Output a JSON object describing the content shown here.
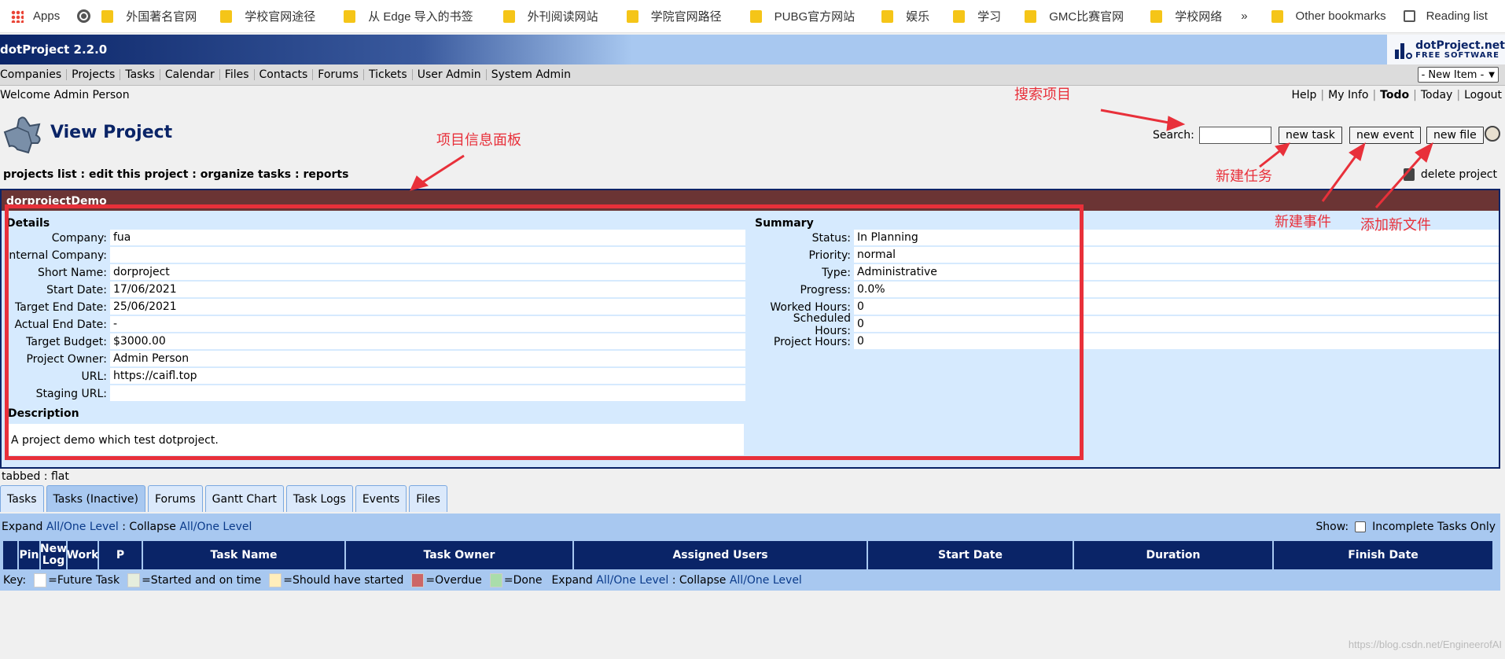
{
  "bookmarks": {
    "apps": "Apps",
    "folders": [
      "外国著名官网",
      "学校官网途径",
      "从 Edge 导入的书签",
      "外刊阅读网站",
      "学院官网路径",
      "PUBG官方网站",
      "娱乐",
      "学习",
      "GMC比赛官网",
      "学校网络"
    ],
    "more": "»",
    "other": "Other bookmarks",
    "reading_list": "Reading list"
  },
  "header": {
    "version": "dotProject 2.2.0",
    "logo_line1": "dotProject.net",
    "logo_line2": "FREE SOFTWARE"
  },
  "nav": [
    "Companies",
    "Projects",
    "Tasks",
    "Calendar",
    "Files",
    "Contacts",
    "Forums",
    "Tickets",
    "User Admin",
    "System Admin"
  ],
  "new_item": "- New Item -",
  "welcome": "Welcome Admin Person",
  "top_links": [
    "Help",
    "My Info",
    "Todo",
    "Today",
    "Logout"
  ],
  "page_title": "View Project",
  "search_label": "Search:",
  "buttons": {
    "new_task": "new task",
    "new_event": "new event",
    "new_file": "new file"
  },
  "project_links": "projects list : edit this project : organize tasks : reports",
  "delete_project": "delete project",
  "project": {
    "name": "dorprojectDemo",
    "details_heading": "Details",
    "details": [
      {
        "label": "Company:",
        "value": "fua"
      },
      {
        "label": "Internal Company:",
        "value": ""
      },
      {
        "label": "Short Name:",
        "value": "dorproject"
      },
      {
        "label": "Start Date:",
        "value": "17/06/2021"
      },
      {
        "label": "Target End Date:",
        "value": "25/06/2021"
      },
      {
        "label": "Actual End Date:",
        "value": "-"
      },
      {
        "label": "Target Budget:",
        "value": "$3000.00"
      },
      {
        "label": "Project Owner:",
        "value": "Admin Person"
      },
      {
        "label": "URL:",
        "value": "https://caifl.top"
      },
      {
        "label": "Staging URL:",
        "value": ""
      }
    ],
    "summary_heading": "Summary",
    "summary": [
      {
        "label": "Status:",
        "value": "In Planning"
      },
      {
        "label": "Priority:",
        "value": "normal"
      },
      {
        "label": "Type:",
        "value": "Administrative"
      },
      {
        "label": "Progress:",
        "value": "0.0%"
      },
      {
        "label": "Worked Hours:",
        "value": "0"
      },
      {
        "label": "Scheduled Hours:",
        "value": "0"
      },
      {
        "label": "Project Hours:",
        "value": "0"
      }
    ],
    "description_heading": "Description",
    "description": "A project demo which test dotproject."
  },
  "annotations": {
    "search": "搜索项目",
    "panel": "项目信息面板",
    "new_task": "新建任务",
    "new_event": "新建事件",
    "new_file": "添加新文件"
  },
  "view_mode": "tabbed : flat",
  "tabs": [
    "Tasks",
    "Tasks (Inactive)",
    "Forums",
    "Gantt Chart",
    "Task Logs",
    "Events",
    "Files"
  ],
  "active_tab": 1,
  "expand_text": {
    "prefix": "Expand ",
    "all": "All",
    "slash": "/",
    "one": "One Level",
    "mid": " : Collapse "
  },
  "show": {
    "label": "Show:",
    "option": "Incomplete Tasks Only"
  },
  "table_headers": [
    "",
    "Pin",
    "New Log",
    "Work",
    "P",
    "Task Name",
    "Task Owner",
    "Assigned Users",
    "Start Date",
    "Duration",
    "Finish Date"
  ],
  "key": {
    "label": "Key:",
    "items": [
      {
        "text": "=Future Task",
        "color": "#ffffff"
      },
      {
        "text": "=Started and on time",
        "color": "#e6eedd"
      },
      {
        "text": "=Should have started",
        "color": "#ffeebb"
      },
      {
        "text": "=Overdue",
        "color": "#cc6666"
      },
      {
        "text": "=Done",
        "color": "#aaddaa"
      }
    ]
  },
  "watermark": "https://blog.csdn.net/EngineerofAI",
  "colors": {
    "accent": "#0a2467",
    "panel_head": "#6b3434",
    "annotation": "#e8303a"
  }
}
